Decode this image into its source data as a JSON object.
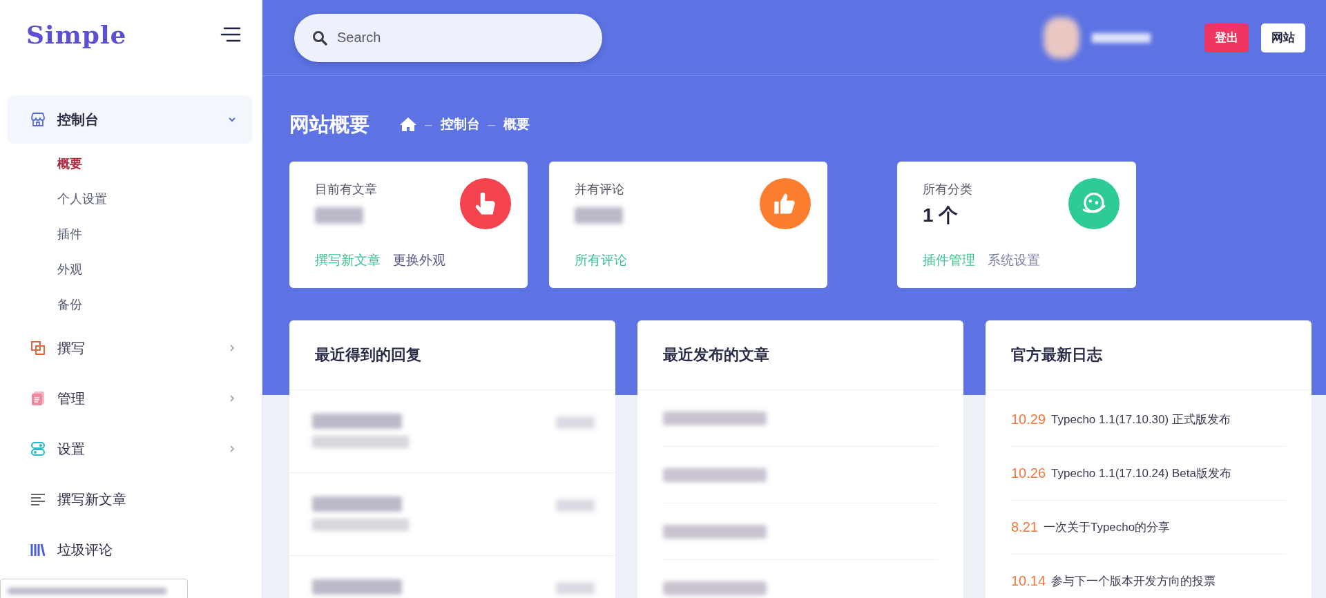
{
  "sidebar": {
    "logo": "Simple",
    "menu": [
      {
        "label": "控制台",
        "kind": "group",
        "expanded": true,
        "children": [
          {
            "label": "概要",
            "selected": true
          },
          {
            "label": "个人设置",
            "selected": false
          },
          {
            "label": "插件",
            "selected": false
          },
          {
            "label": "外观",
            "selected": false
          },
          {
            "label": "备份",
            "selected": false
          }
        ]
      },
      {
        "label": "撰写",
        "kind": "group",
        "expanded": false
      },
      {
        "label": "管理",
        "kind": "group",
        "expanded": false
      },
      {
        "label": "设置",
        "kind": "group",
        "expanded": false
      },
      {
        "label": "撰写新文章",
        "kind": "link"
      },
      {
        "label": "垃圾评论",
        "kind": "link"
      }
    ]
  },
  "topbar": {
    "search": {
      "placeholder": "Search"
    },
    "buttons": [
      {
        "label": "登出",
        "kind": "danger"
      },
      {
        "label": "网站",
        "kind": "light"
      }
    ]
  },
  "page": {
    "title": "网站概要",
    "breadcrumb": [
      {
        "kind": "home"
      },
      {
        "kind": "sep",
        "text": "–"
      },
      {
        "kind": "link",
        "text": "控制台"
      },
      {
        "kind": "sep",
        "text": "–"
      },
      {
        "kind": "current",
        "text": "概要"
      }
    ]
  },
  "stats": [
    {
      "label": "目前有文章",
      "redacted": true,
      "color": "#f2434f",
      "links": [
        {
          "text": "撰写新文章",
          "color": "#3ec28f"
        },
        {
          "text": "更换外观",
          "color": "#575c8a"
        }
      ]
    },
    {
      "label": "并有评论",
      "redacted": true,
      "color": "#fb7d2f",
      "links": [
        {
          "text": "所有评论",
          "color": "#3ec28f"
        }
      ]
    },
    {
      "label": "所有分类",
      "value": "1 个",
      "color": "#2ccb98",
      "links": [
        {
          "text": "插件管理",
          "color": "#3ec28f"
        },
        {
          "text": "系统设置",
          "color": "#7b7fa6"
        }
      ]
    }
  ],
  "panels": [
    {
      "title": "最近得到的回复",
      "items": [
        {
          "kind": "redacted-reply"
        },
        {
          "kind": "redacted-reply"
        },
        {
          "kind": "redacted-reply"
        }
      ]
    },
    {
      "title": "最近发布的文章",
      "items": [
        {
          "kind": "redacted-post"
        },
        {
          "kind": "redacted-post"
        },
        {
          "kind": "redacted-post"
        },
        {
          "kind": "redacted-post"
        }
      ]
    },
    {
      "title": "官方最新日志",
      "items": [
        {
          "kind": "log",
          "date": "10.29",
          "text": "Typecho 1.1(17.10.30) 正式版发布"
        },
        {
          "kind": "log",
          "date": "10.26",
          "text": "Typecho 1.1(17.10.24) Beta版发布"
        },
        {
          "kind": "log",
          "date": "8.21",
          "text": "一次关于Typecho的分享"
        },
        {
          "kind": "log",
          "date": "10.14",
          "text": "参与下一个版本开发方向的投票"
        }
      ]
    }
  ]
}
